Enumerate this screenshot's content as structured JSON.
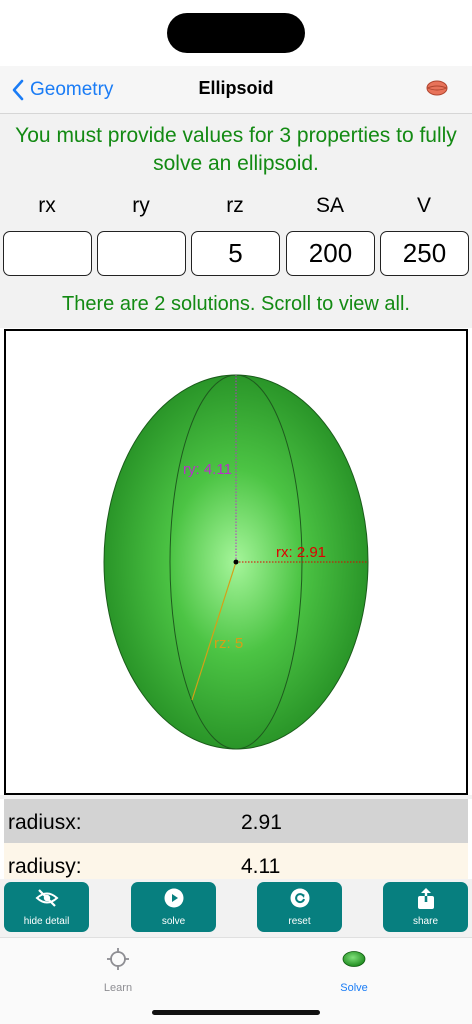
{
  "nav": {
    "back_label": "Geometry",
    "title": "Ellipsoid"
  },
  "instruction": "You must provide values for 3 properties to fully solve an ellipsoid.",
  "properties": [
    {
      "label": "rx",
      "value": ""
    },
    {
      "label": "ry",
      "value": ""
    },
    {
      "label": "rz",
      "value": "5"
    },
    {
      "label": "SA",
      "value": "200"
    },
    {
      "label": "V",
      "value": "250"
    }
  ],
  "solutions_message": "There are 2 solutions. Scroll to view all.",
  "diagram": {
    "rx_label": "rx: 2.91",
    "ry_label": "ry: 4.11",
    "rz_label": "rz: 5",
    "colors": {
      "rx": "#e00000",
      "ry": "#b832c8",
      "rz": "#d4a017",
      "fill": "#2e9e2e"
    }
  },
  "results": [
    {
      "key": "radiusx:",
      "value": "2.91"
    },
    {
      "key": "radiusy:",
      "value": "4.11"
    }
  ],
  "actions": {
    "hide_detail": "hide detail",
    "solve": "solve",
    "reset": "reset",
    "share": "share"
  },
  "tabs": {
    "learn": "Learn",
    "solve": "Solve"
  },
  "accent": "#1a7cf5",
  "button_color": "#077f7f",
  "message_color": "#138a13"
}
